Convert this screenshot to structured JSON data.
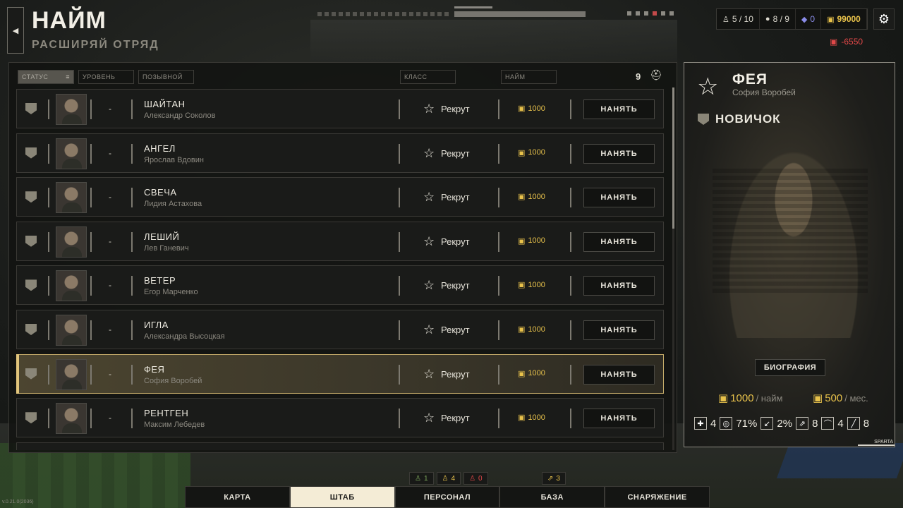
{
  "header": {
    "title": "НАЙМ",
    "subtitle": "РАСШИРЯЙ ОТРЯД",
    "back_icon": "◀"
  },
  "resources": {
    "squad": "5 / 10",
    "people": "8 / 9",
    "diamonds": "0",
    "money": "99000",
    "debt": "-6550"
  },
  "filters": {
    "status": "СТАТУС",
    "level": "УРОВЕНЬ",
    "callsign": "ПОЗЫВНОЙ",
    "class": "КЛАСС",
    "hire": "НАЙМ",
    "count": "9"
  },
  "rows": [
    {
      "callsign": "ШАЙТАН",
      "name": "Александр Соколов",
      "level": "-",
      "class": "Рекрут",
      "price": "1000",
      "action": "НАНЯТЬ"
    },
    {
      "callsign": "АНГЕЛ",
      "name": "Ярослав Вдовин",
      "level": "-",
      "class": "Рекрут",
      "price": "1000",
      "action": "НАНЯТЬ"
    },
    {
      "callsign": "СВЕЧА",
      "name": "Лидия Астахова",
      "level": "-",
      "class": "Рекрут",
      "price": "1000",
      "action": "НАНЯТЬ"
    },
    {
      "callsign": "ЛЕШИЙ",
      "name": "Лев Ганевич",
      "level": "-",
      "class": "Рекрут",
      "price": "1000",
      "action": "НАНЯТЬ"
    },
    {
      "callsign": "ВЕТЕР",
      "name": "Егор Марченко",
      "level": "-",
      "class": "Рекрут",
      "price": "1000",
      "action": "НАНЯТЬ"
    },
    {
      "callsign": "ИГЛА",
      "name": "Александра Высоцкая",
      "level": "-",
      "class": "Рекрут",
      "price": "1000",
      "action": "НАНЯТЬ"
    },
    {
      "callsign": "ФЕЯ",
      "name": "София Воробей",
      "level": "-",
      "class": "Рекрут",
      "price": "1000",
      "action": "НАНЯТЬ"
    },
    {
      "callsign": "РЕНТГЕН",
      "name": "Максим Лебедев",
      "level": "-",
      "class": "Рекрут",
      "price": "1000",
      "action": "НАНЯТЬ"
    }
  ],
  "detail": {
    "callsign": "ФЕЯ",
    "name": "София Воробей",
    "rank": "НОВИЧОК",
    "bio_button": "БИОГРАФИЯ",
    "hire_cost": "1000",
    "hire_unit": "/ найм",
    "monthly_cost": "500",
    "monthly_unit": "/ мес.",
    "stats": [
      {
        "icon": "health-icon",
        "value": "4"
      },
      {
        "icon": "aim-icon",
        "value": "71%"
      },
      {
        "icon": "evasion-icon",
        "value": "2%"
      },
      {
        "icon": "run-icon",
        "value": "8"
      },
      {
        "icon": "crouch-icon",
        "value": "4"
      },
      {
        "icon": "melee-icon",
        "value": "8"
      }
    ],
    "brand": "SPARTA"
  },
  "mini_stats": {
    "green": "1",
    "gold": "4",
    "red": "0",
    "extra": "3"
  },
  "nav": {
    "map": "КАРТА",
    "hq": "ШТАБ",
    "staff": "ПЕРСОНАЛ",
    "base": "БАЗА",
    "equipment": "СНАРЯЖЕНИЕ"
  },
  "version": "v.0.21.0(2036)",
  "colors": {
    "accent_gold": "#e8c24b",
    "selected_border": "#c4ab6a",
    "debt_red": "#e04848",
    "active_tab": "#f4ecd6"
  }
}
